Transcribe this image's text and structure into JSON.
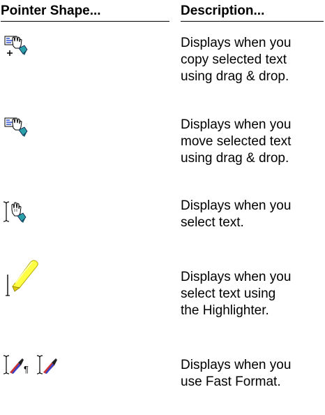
{
  "headers": {
    "pointer_shape": "Pointer Shape...",
    "description": "Description..."
  },
  "rows": [
    {
      "icons": [
        "copy-drag-drop-pointer-icon"
      ],
      "description": "Displays when you\ncopy selected text\nusing drag & drop."
    },
    {
      "icons": [
        "move-drag-drop-pointer-icon"
      ],
      "description": "Displays when you\nmove selected text\nusing drag & drop."
    },
    {
      "icons": [
        "select-text-hand-pointer-icon"
      ],
      "description": "Displays when you\nselect text."
    },
    {
      "icons": [
        "highlighter-pointer-icon"
      ],
      "description": "Displays when you\nselect text using\nthe Highlighter."
    },
    {
      "icons": [
        "fast-format-paragraph-pointer-icon",
        "fast-format-pointer-icon"
      ],
      "description": "Displays when you\nuse Fast Format."
    }
  ],
  "colors": {
    "text": "#000000",
    "background": "#ffffff",
    "highlighter": "#ffff44",
    "pointer_tip": "#2aa0a8",
    "document_lines": "#2244cc"
  }
}
